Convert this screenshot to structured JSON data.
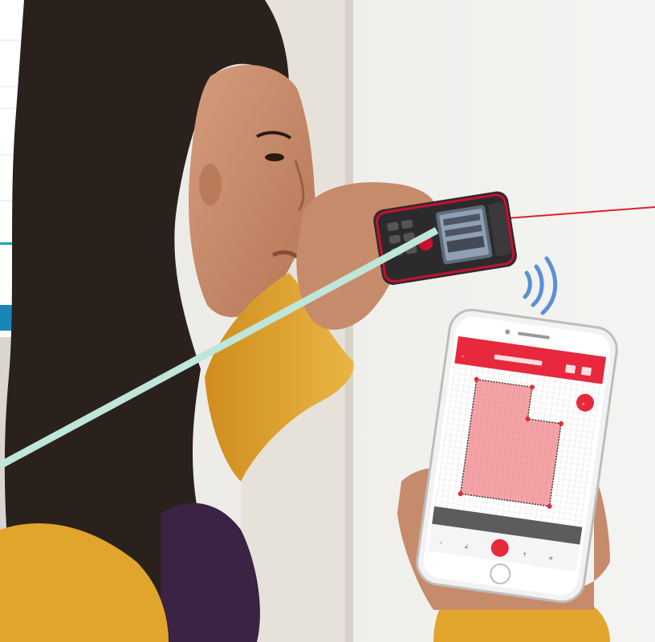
{
  "scene": {
    "description_colors": {
      "wall": "#eeeeec",
      "sleeve": "#e2a52c",
      "hair": "#2a211d",
      "skin": "#c38a6a",
      "scarf": "#3a2343",
      "device_body": "#2b2b2d",
      "device_accent": "#c8102e",
      "laser": "#e0202a",
      "signal": "#5b8fd6",
      "app_header": "#e8283c",
      "floorplan_fill": "#f4a3a6",
      "overlay_line": "#bfe6da",
      "teal_stroke": "#1aa6b2"
    }
  },
  "phone_app": {
    "has_back_chevron": true,
    "tool_icons": [
      "line-tool-icon",
      "angle-tool-icon",
      "laser-target-icon",
      "text-tool-icon",
      "undo-icon"
    ]
  }
}
